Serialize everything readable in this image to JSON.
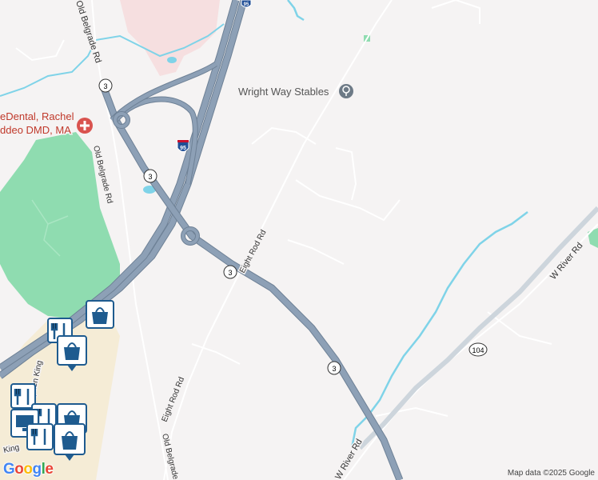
{
  "map": {
    "attribution": "Map data ©2025 Google",
    "logo": {
      "letters": [
        "G",
        "o",
        "o",
        "g",
        "l",
        "e"
      ],
      "colors": [
        "#4285f4",
        "#ea4335",
        "#fbbc05",
        "#4285f4",
        "#34a853",
        "#ea4335"
      ]
    },
    "colors": {
      "land": "#f5f3f3",
      "highway": "#8da0b6",
      "highway_outline": "#6e8196",
      "road": "#ffffff",
      "water": "#7fd3e8",
      "park": "#8fdcb0",
      "urban": "#f6dfe0",
      "commercial": "#f5ecd6",
      "poi_blue": "#1e5b8f",
      "poi_medical": "#d9534f"
    }
  },
  "pois": [
    {
      "name": "Wright Way Stables",
      "icon": "horse-stable-icon"
    },
    {
      "name_line1": "eDental, Rachel",
      "name_line2": "ddeo DMD, MA",
      "icon": "medical-cross-icon"
    }
  ],
  "roads": {
    "old_belgrade_top": "Old Belgrade Rd",
    "old_belgrade_mid": "Old Belgrade Rd",
    "old_belgrade_bottom": "Old Belgrade",
    "eight_rod_upper": "Eight Rod Rd",
    "eight_rod_lower": "Eight Rod Rd",
    "w_river_upper": "W River Rd",
    "w_river_lower": "W River Rd",
    "stephen_king": "Stephen King",
    "king": "King"
  },
  "shields": {
    "i95_top": "95",
    "i95_mid": "95",
    "rt3_a": "3",
    "rt3_b": "3",
    "rt3_c": "3",
    "rt3_d": "3",
    "rt104": "104"
  },
  "markers": [
    "shopping-bag-icon",
    "restaurant-icon",
    "shopping-bag-icon",
    "restaurant-icon",
    "restaurant-icon",
    "shopping-bag-icon",
    "monitor-icon",
    "restaurant-icon",
    "shopping-bag-icon"
  ]
}
